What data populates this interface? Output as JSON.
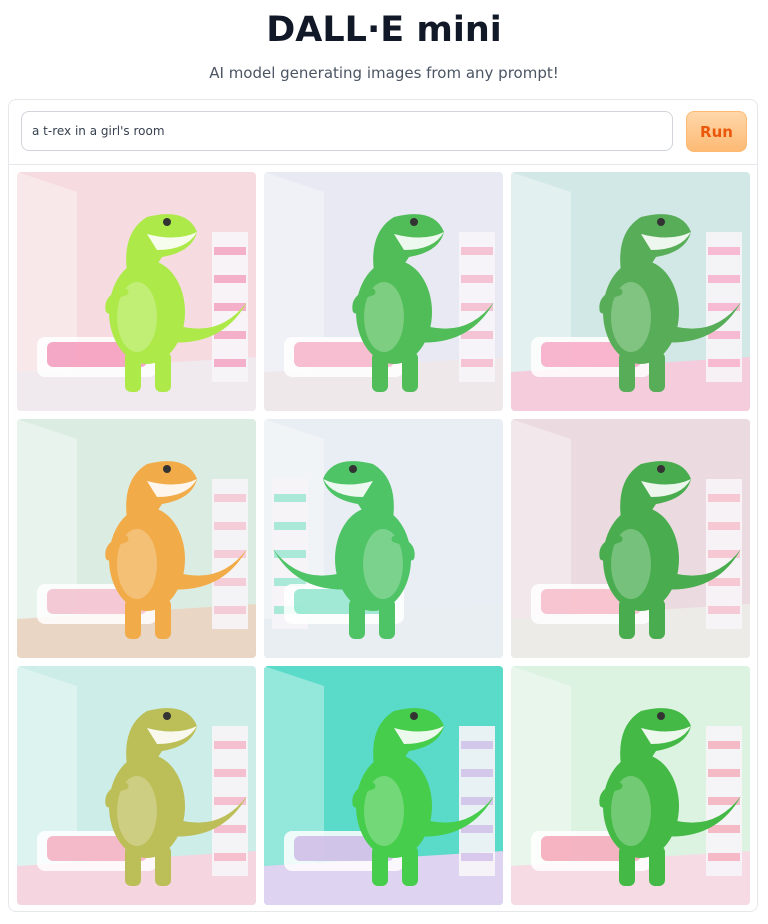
{
  "header": {
    "title": "DALL·E mini",
    "subtitle": "AI model generating images from any prompt!"
  },
  "prompt": {
    "value": "a t-rex in a girl's room",
    "run_label": "Run"
  },
  "colors": {
    "accent": "#ea580c",
    "button_bg": "#fdba74",
    "border": "#e5e7eb"
  },
  "gallery": {
    "images": [
      {
        "name": "generated-image-1",
        "wall": "#f6d9de",
        "floor": "#efe9ee",
        "dino": "#a6e83a",
        "accent": "#f28ab0",
        "facing": "left"
      },
      {
        "name": "generated-image-2",
        "wall": "#e6e8f2",
        "floor": "#ede6ea",
        "dino": "#43b84a",
        "accent": "#f4a7c0",
        "facing": "left"
      },
      {
        "name": "generated-image-3",
        "wall": "#cfe6e5",
        "floor": "#f3c8d8",
        "dino": "#4aa84a",
        "accent": "#f79bbd",
        "facing": "left"
      },
      {
        "name": "generated-image-4",
        "wall": "#d8ece0",
        "floor": "#e9d3c0",
        "dino": "#f0a53a",
        "accent": "#f2b7c8",
        "facing": "left"
      },
      {
        "name": "generated-image-5",
        "wall": "#e6edf2",
        "floor": "#e7edf0",
        "dino": "#3fbf5a",
        "accent": "#7fe2c6",
        "facing": "right"
      },
      {
        "name": "generated-image-6",
        "wall": "#ead7dd",
        "floor": "#eceae6",
        "dino": "#3aa640",
        "accent": "#f5b0c2",
        "facing": "left"
      },
      {
        "name": "generated-image-7",
        "wall": "#c8ece6",
        "floor": "#f3d2de",
        "dino": "#b7b94a",
        "accent": "#f4a2b8",
        "facing": "left"
      },
      {
        "name": "generated-image-8",
        "wall": "#4cd7c4",
        "floor": "#dcd0f0",
        "dino": "#36c93c",
        "accent": "#c7b1e4",
        "facing": "left"
      },
      {
        "name": "generated-image-9",
        "wall": "#dbf2e0",
        "floor": "#f6d8e3",
        "dino": "#35b437",
        "accent": "#f49aac",
        "facing": "left"
      }
    ]
  }
}
